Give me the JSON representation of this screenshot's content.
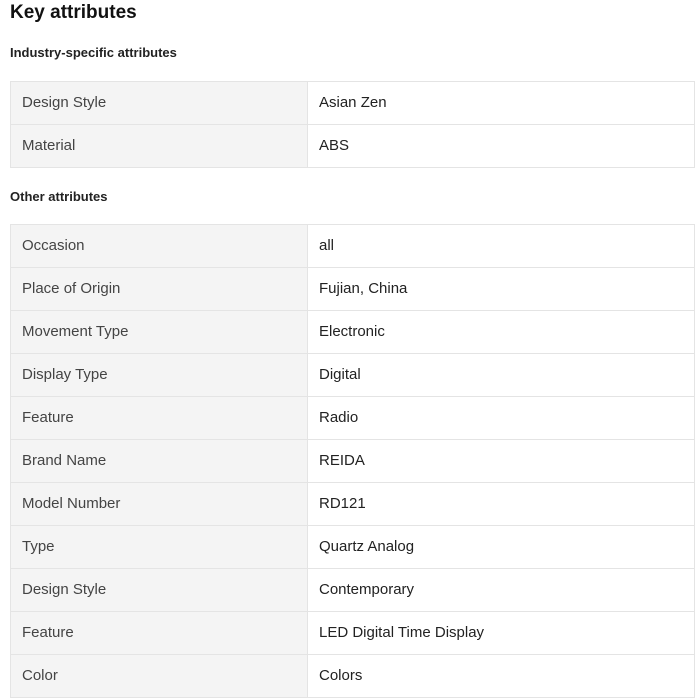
{
  "header": {
    "title": "Key attributes"
  },
  "sections": [
    {
      "title": "Industry-specific attributes",
      "rows": [
        {
          "key": "Design Style",
          "value": "Asian Zen"
        },
        {
          "key": "Material",
          "value": "ABS"
        }
      ]
    },
    {
      "title": "Other attributes",
      "rows": [
        {
          "key": "Occasion",
          "value": "all"
        },
        {
          "key": "Place of Origin",
          "value": "Fujian, China"
        },
        {
          "key": "Movement Type",
          "value": "Electronic"
        },
        {
          "key": "Display Type",
          "value": "Digital"
        },
        {
          "key": "Feature",
          "value": "Radio"
        },
        {
          "key": "Brand Name",
          "value": "REIDA"
        },
        {
          "key": "Model Number",
          "value": "RD121"
        },
        {
          "key": "Type",
          "value": "Quartz Analog"
        },
        {
          "key": "Design Style",
          "value": "Contemporary"
        },
        {
          "key": "Feature",
          "value": "LED Digital Time Display"
        },
        {
          "key": "Color",
          "value": "Colors"
        }
      ]
    }
  ]
}
